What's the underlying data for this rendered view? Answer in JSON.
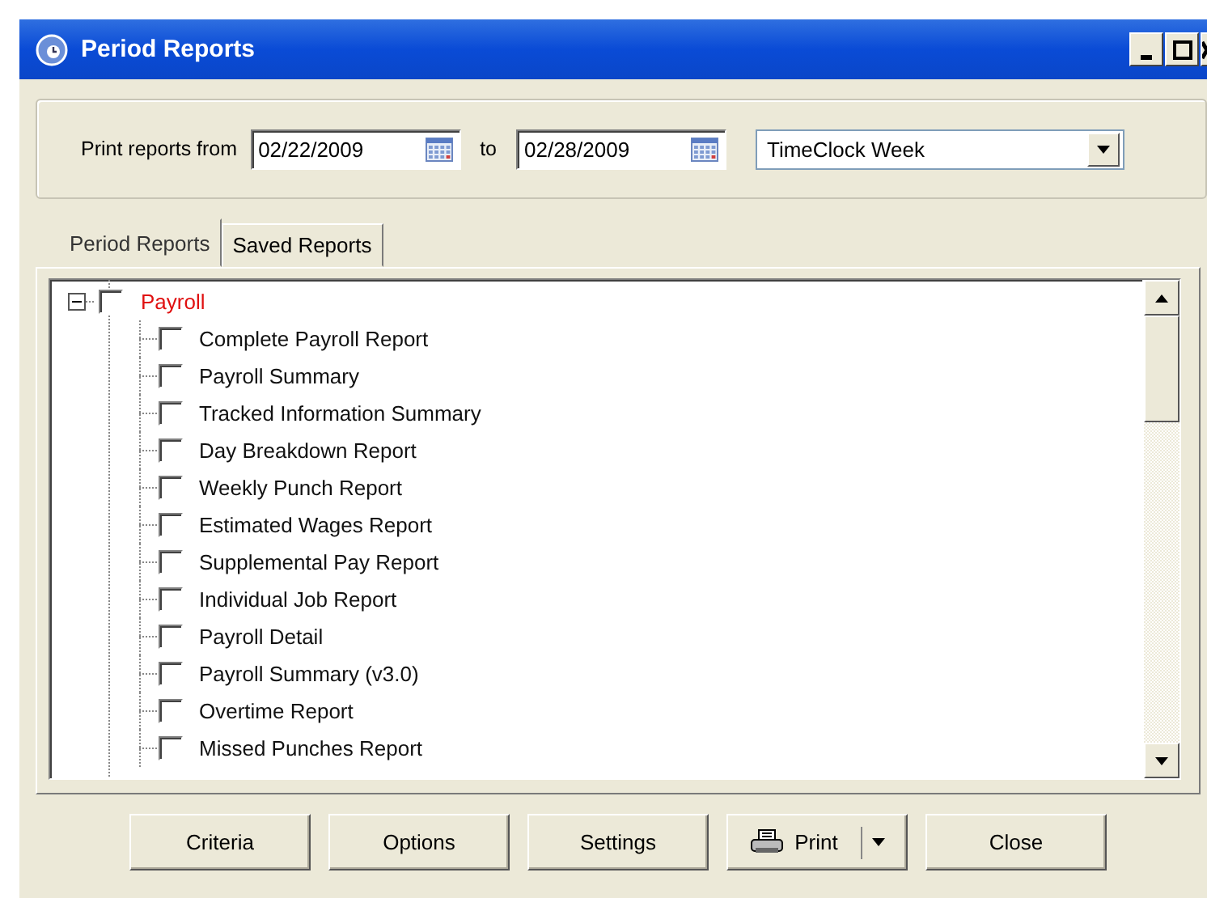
{
  "window": {
    "title": "Period Reports"
  },
  "range": {
    "label": "Print reports from",
    "from": "02/22/2009",
    "to_label": "to",
    "to": "02/28/2009",
    "period": "TimeClock Week"
  },
  "tabs": [
    {
      "label": "Period Reports",
      "selected": true
    },
    {
      "label": "Saved Reports",
      "selected": false
    }
  ],
  "tree": [
    {
      "label": "Payroll",
      "checked": false,
      "expanded": true,
      "children": [
        {
          "label": "Complete Payroll Report",
          "checked": false
        },
        {
          "label": "Payroll Summary",
          "checked": false
        },
        {
          "label": "Tracked Information Summary",
          "checked": false
        },
        {
          "label": "Day Breakdown Report",
          "checked": false
        },
        {
          "label": "Weekly Punch Report",
          "checked": false
        },
        {
          "label": "Estimated Wages Report",
          "checked": false
        },
        {
          "label": "Supplemental Pay Report",
          "checked": false
        },
        {
          "label": "Individual Job Report",
          "checked": false
        },
        {
          "label": "Payroll Detail",
          "checked": false
        },
        {
          "label": "Payroll Summary (v3.0)",
          "checked": false
        },
        {
          "label": "Overtime Report",
          "checked": false
        },
        {
          "label": "Missed Punches Report",
          "checked": false
        }
      ]
    }
  ],
  "buttons": [
    {
      "label": "Criteria",
      "kind": "plain"
    },
    {
      "label": "Options",
      "kind": "plain"
    },
    {
      "label": "Settings",
      "kind": "plain"
    },
    {
      "label": "Print",
      "kind": "split"
    },
    {
      "label": "Close",
      "kind": "plain"
    }
  ]
}
